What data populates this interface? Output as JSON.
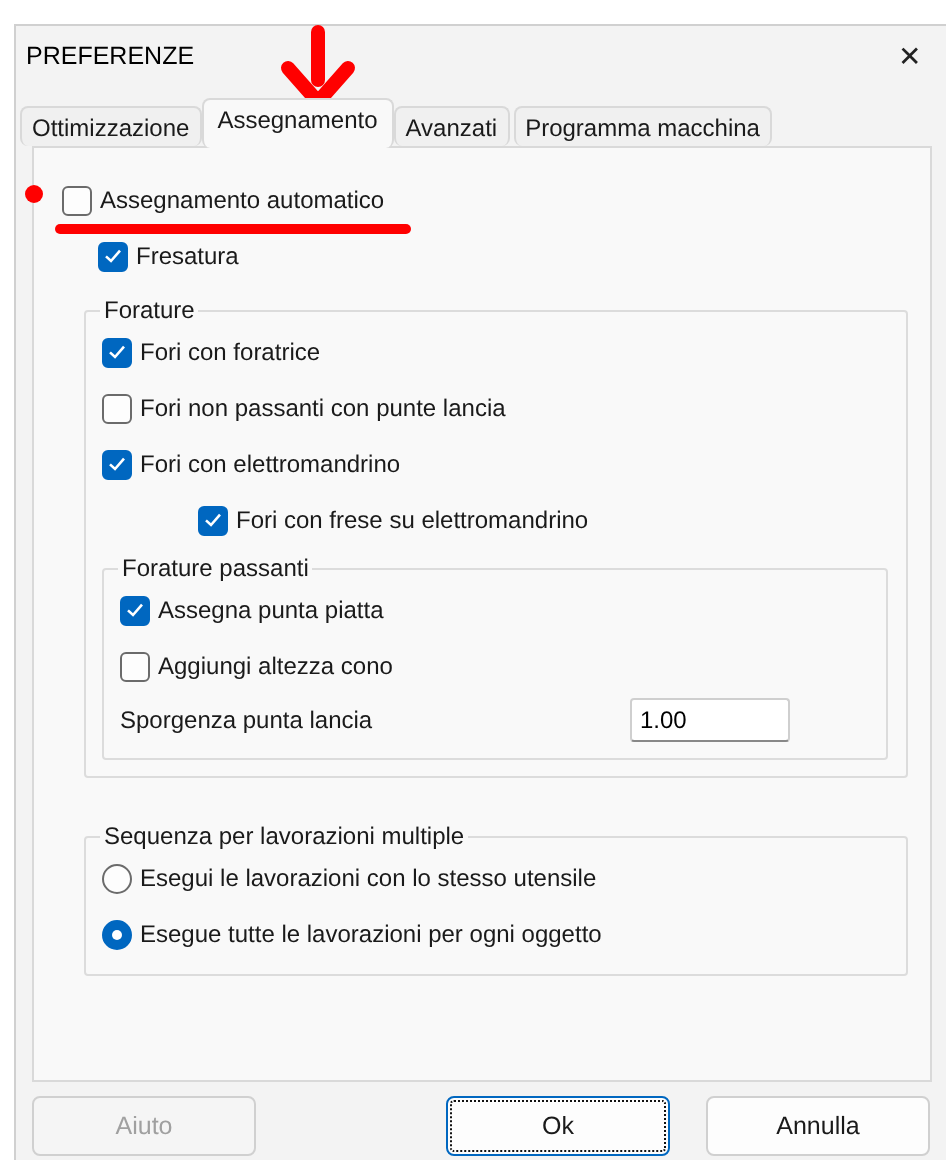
{
  "window": {
    "title": "PREFERENZE",
    "close": "✕"
  },
  "tabs": [
    {
      "label": "Ottimizzazione",
      "selected": false
    },
    {
      "label": "Assegnamento",
      "selected": true
    },
    {
      "label": "Avanzati",
      "selected": false
    },
    {
      "label": "Programma macchina",
      "selected": false
    }
  ],
  "auto_assign": {
    "label": "Assegnamento automatico",
    "checked": false
  },
  "milling": {
    "label": "Fresatura",
    "checked": true
  },
  "drilling": {
    "title": "Forature",
    "options": [
      {
        "label": "Fori con foratrice",
        "checked": true
      },
      {
        "label": "Fori non passanti con punte lancia",
        "checked": false
      },
      {
        "label": "Fori con elettromandrino",
        "checked": true,
        "children": [
          {
            "label": "Fori con frese su elettromandrino",
            "checked": true
          }
        ]
      }
    ],
    "through": {
      "title": "Forature passanti",
      "options": [
        {
          "label": "Assegna punta piatta",
          "checked": true
        },
        {
          "label": "Aggiungi altezza cono",
          "checked": false
        }
      ],
      "field": {
        "label": "Sporgenza punta lancia",
        "value": "1.00"
      }
    }
  },
  "sequence": {
    "title": "Sequenza per lavorazioni multiple",
    "options": [
      {
        "label": "Esegui le lavorazioni con lo stesso utensile",
        "selected": false
      },
      {
        "label": "Esegue tutte le lavorazioni per ogni oggetto",
        "selected": true
      }
    ]
  },
  "buttons": [
    {
      "label": "Aiuto",
      "disabled": true,
      "focused": false
    },
    {
      "label": "Ok",
      "disabled": false,
      "focused": true
    },
    {
      "label": "Annulla",
      "disabled": false,
      "focused": false
    }
  ]
}
